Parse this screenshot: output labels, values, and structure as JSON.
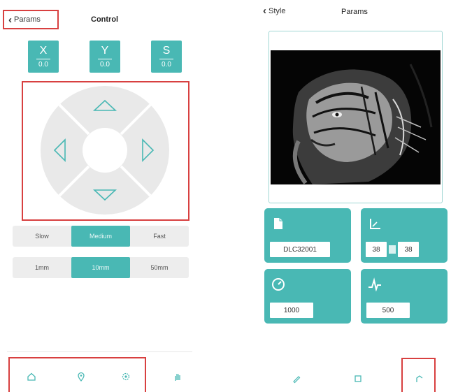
{
  "left": {
    "back_label": "Params",
    "title": "Control",
    "axes": [
      {
        "label": "X",
        "value": "0.0"
      },
      {
        "label": "Y",
        "value": "0.0"
      },
      {
        "label": "S",
        "value": "0.0"
      }
    ],
    "speed_options": [
      "Slow",
      "Medium",
      "Fast"
    ],
    "speed_selected": "Medium",
    "step_options": [
      "1mm",
      "10mm",
      "50mm"
    ],
    "step_selected": "10mm",
    "tabs": [
      "home-icon",
      "location-pin-icon",
      "settings-icon",
      "hand-icon"
    ]
  },
  "right": {
    "back_label": "Style",
    "title": "Params",
    "cards": {
      "file": {
        "value": "DLC32001"
      },
      "size": {
        "width": "38",
        "height": "38"
      },
      "speed": {
        "value": "1000"
      },
      "power": {
        "value": "500"
      }
    },
    "tabs": [
      "pen-icon",
      "frame-icon",
      "upload-icon"
    ]
  },
  "colors": {
    "accent": "#49b8b4",
    "highlight": "#d84040",
    "dpad": "#e9e9e9"
  }
}
